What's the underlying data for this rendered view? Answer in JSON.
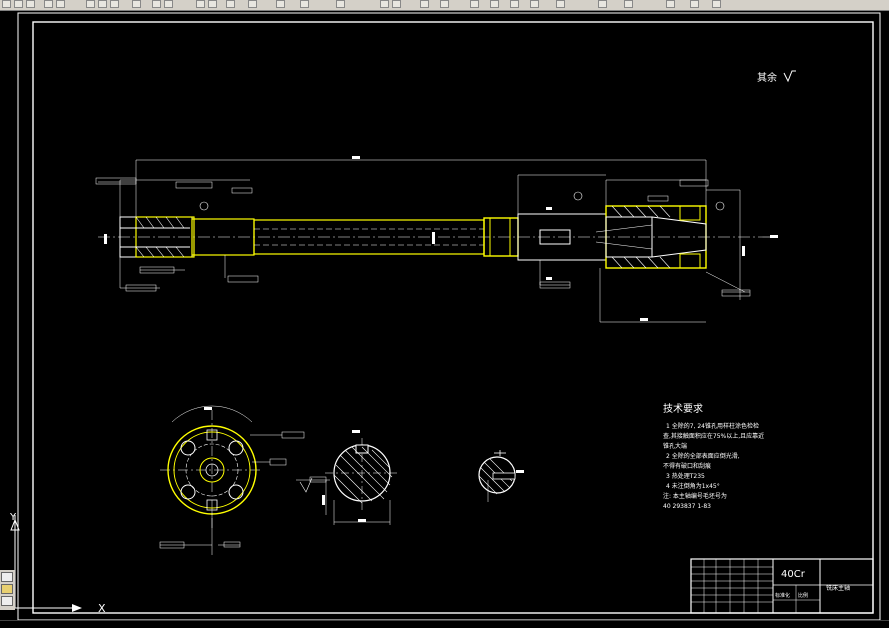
{
  "drawing": {
    "surface_finish_note": "其余",
    "tech_req": {
      "title": "技术要求",
      "lines": [
        "1   全除的7, 24锥孔用样柱涂色检检",
        "查,其接触面积应在75%以上,且应靠近",
        "锥孔大端",
        "2   全除的全部表面应倒光滑,",
        "不得有破口和刮痕",
        "3   热处理T235",
        "4   未注倒角为1x45°",
        "注: 本主轴编号毛坯号为",
        "     40 293837 1-83"
      ]
    },
    "title_block": {
      "material": "40Cr",
      "part_name": "铣床主轴",
      "cell_a": "标准化",
      "cell_b": "比例"
    },
    "axis": {
      "y_label": "Y",
      "x_label": "X"
    }
  },
  "colors": {
    "background": "#000000",
    "line": "#ffffff",
    "part": "#ffff00",
    "toolbar": "#d4d0c8"
  }
}
